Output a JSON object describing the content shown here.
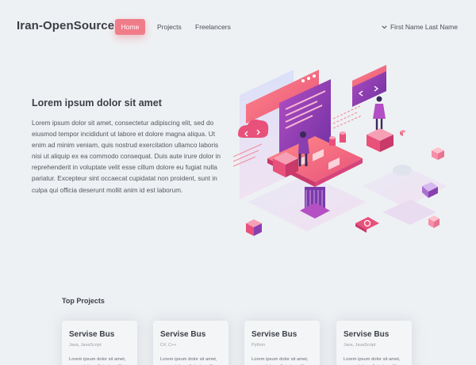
{
  "nav": {
    "brand": "Iran-OpenSource",
    "links": [
      {
        "label": "Home",
        "active": true
      },
      {
        "label": "Projects",
        "active": false
      },
      {
        "label": "Freelancers",
        "active": false
      }
    ],
    "user_label": "First Name Last Name"
  },
  "hero": {
    "title": "Lorem ipsum dolor sit amet",
    "text": "Lorem ipsum dolor sit amet, consectetur adipiscing elit, sed do eiusmod tempor incididunt ut labore et dolore magna aliqua. Ut enim ad minim veniam, quis nostrud exercitation ullamco laboris nisi ut aliquip ex ea commodo consequat. Duis aute irure dolor in reprehenderit in voluptate velit esse cillum dolore eu fugiat nulla pariatur. Excepteur sint occaecat cupidatat non proident, sunt in culpa qui officia deserunt mollit anim id est laborum.",
    "illustration_icons": [
      "cloud-code-icon",
      "code-window-icon",
      "at-sign-icon",
      "code-braces-icon"
    ]
  },
  "projects": {
    "title": "Top Projects",
    "cards": [
      {
        "title": "Servise Bus",
        "tags": "Java, JavaScript",
        "desc": "Lorem ipsum dolor sit amet, consectetur adipiscing elit, sed"
      },
      {
        "title": "Servise Bus",
        "tags": "C#, C++",
        "desc": "Lorem ipsum dolor sit amet, consectetur adipiscing elit, sed"
      },
      {
        "title": "Servise Bus",
        "tags": "Python",
        "desc": "Lorem ipsum dolor sit amet, consectetur adipiscing elit, sed"
      },
      {
        "title": "Servise Bus",
        "tags": "Java, JavaScript",
        "desc": "Lorem ipsum dolor sit amet, consectetur adipiscing elit, sed"
      }
    ]
  },
  "colors": {
    "accent": "#f07c8a",
    "background": "#eef1f3",
    "illustration_purple": "#8a3fb0"
  }
}
